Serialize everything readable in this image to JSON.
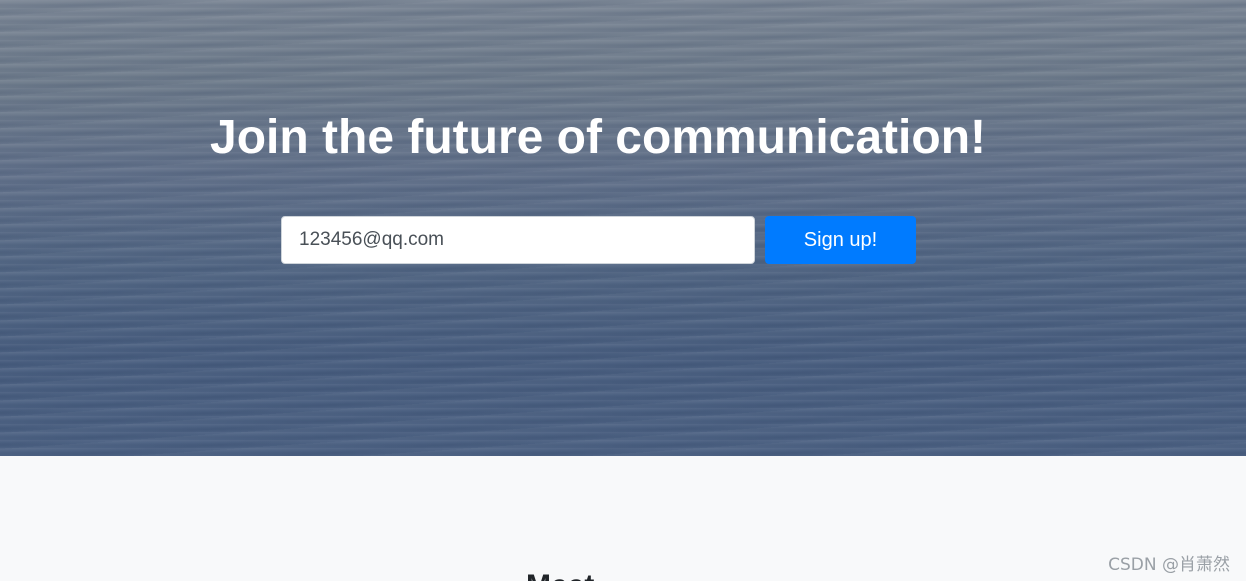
{
  "hero": {
    "title": "Join the future of communication!",
    "email": {
      "value": "123456@qq.com"
    },
    "signup_label": "Sign up!"
  },
  "section": {
    "heading": "Meet ..."
  },
  "watermark": "CSDN @肖萧然",
  "colors": {
    "accent": "#007bff",
    "section_background": "#f8f9fa",
    "hero_text": "#ffffff"
  }
}
